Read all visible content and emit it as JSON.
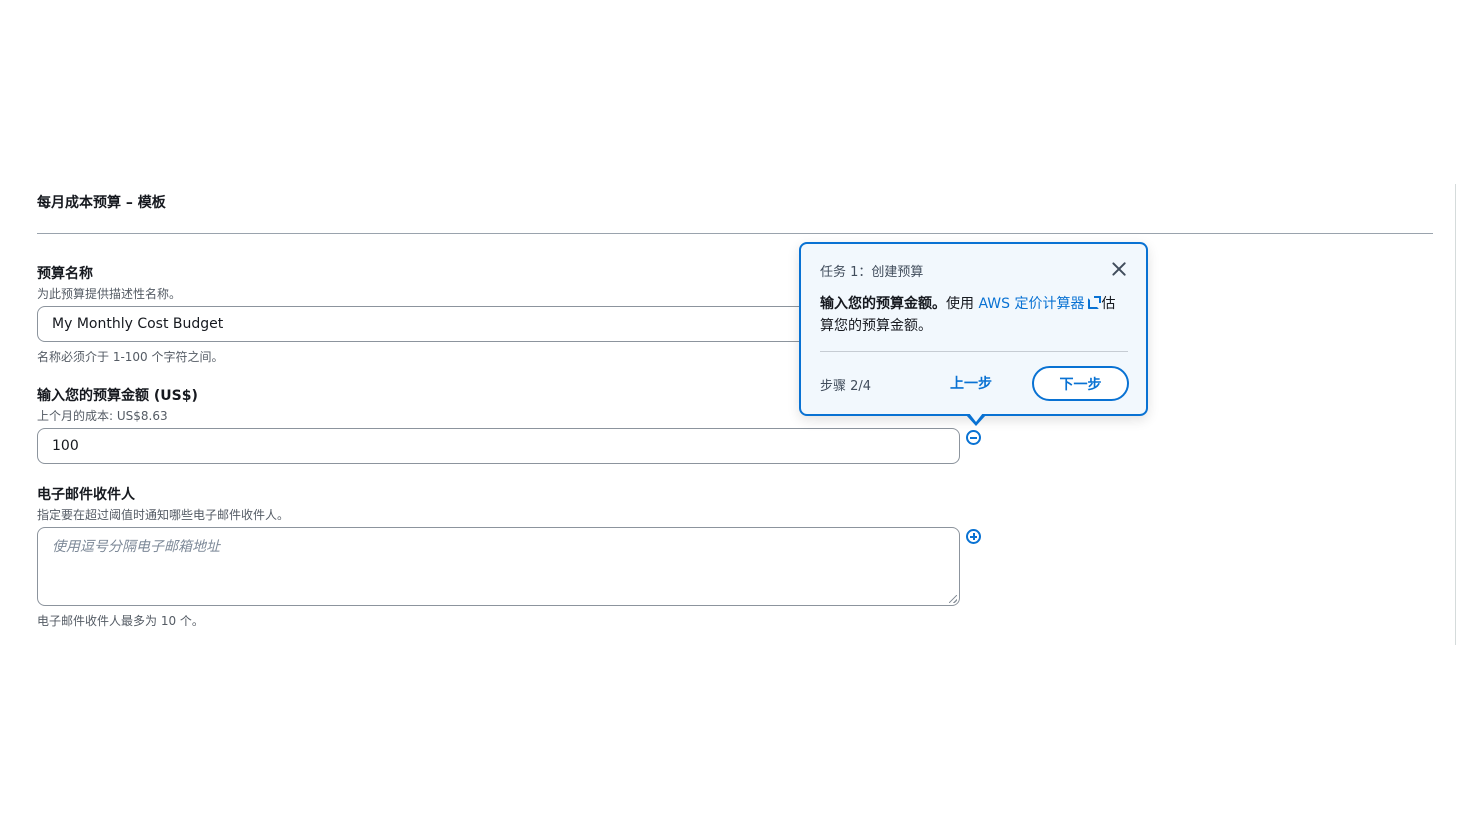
{
  "form": {
    "section_title": "每月成本预算 – 模板",
    "budget_name": {
      "label": "预算名称",
      "description": "为此预算提供描述性名称。",
      "value": "My Monthly Cost Budget",
      "constraint": "名称必须介于 1-100 个字符之间。"
    },
    "budget_amount": {
      "label": "输入您的预算金额 (US$)",
      "description": "上个月的成本: US$8.63",
      "value": "100"
    },
    "email_recipients": {
      "label": "电子邮件收件人",
      "description": "指定要在超过阈值时通知哪些电子邮件收件人。",
      "placeholder": "使用逗号分隔电子邮箱地址",
      "constraint": "电子邮件收件人最多为 10 个。"
    }
  },
  "popover": {
    "header": "任务 1：创建预算",
    "body_bold": "输入您的预算金额。",
    "body_pre": "使用 ",
    "link_text": "AWS 定价计算器",
    "body_post": "估算您的预算金额。",
    "step": "步骤 2/4",
    "prev_label": "上一步",
    "next_label": "下一步"
  },
  "icons": {
    "amount_field_status": "minus-circle-icon",
    "email_field_status": "plus-circle-icon",
    "close": "close-icon",
    "external_link": "external-link-icon"
  },
  "colors": {
    "accent": "#0972d3",
    "popover_bg": "#f2f8fd"
  }
}
